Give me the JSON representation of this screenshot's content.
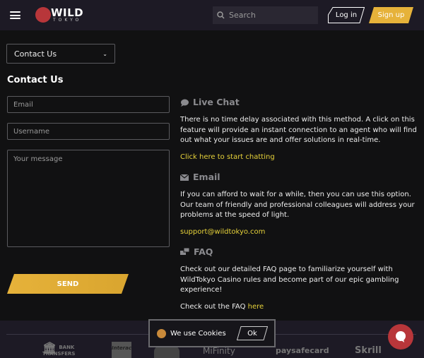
{
  "header": {
    "brand_top": "WILD",
    "brand_bottom": "TOKYO",
    "search_placeholder": "Search",
    "login": "Log in",
    "signup": "Sign up"
  },
  "colors": {
    "accent": "#e6b23a",
    "link": "#e6d23a",
    "header_bg": "#1d1a25",
    "page_bg": "#111112",
    "brand_red": "#b8363a"
  },
  "nav_select": {
    "value": "Contact Us"
  },
  "form": {
    "title": "Contact Us",
    "email_placeholder": "Email",
    "username_placeholder": "Username",
    "message_placeholder": "Your message",
    "send": "SEND"
  },
  "sections": [
    {
      "icon": "chat-bubble-icon",
      "title": "Live Chat",
      "text": "There is no time delay associated with this method. A click on this feature will provide an instant connection to an agent who will find out what your issues are and offer solutions in real-time.",
      "link": "Click here to start chatting"
    },
    {
      "icon": "envelope-icon",
      "title": "Email",
      "text": "If you can afford to wait for a while, then you can use this option. Our team of friendly and professional colleagues will address your problems at the speed of light.",
      "link": "support@wildtokyo.com"
    },
    {
      "icon": "faq-icon",
      "title": "FAQ",
      "text": "Check out our detailed FAQ page to familiarize yourself with WildTokyo Casino rules and become part of our epic gambling experience!",
      "link_prefix": "Check out the FAQ ",
      "link": "here"
    }
  ],
  "footer": {
    "payments": [
      "BANK",
      "TRANSFERS",
      "Interac",
      "MiFinity",
      "paysafecard",
      "Skrill"
    ]
  },
  "cookie": {
    "text": "We use Cookies",
    "ok": "Ok"
  }
}
